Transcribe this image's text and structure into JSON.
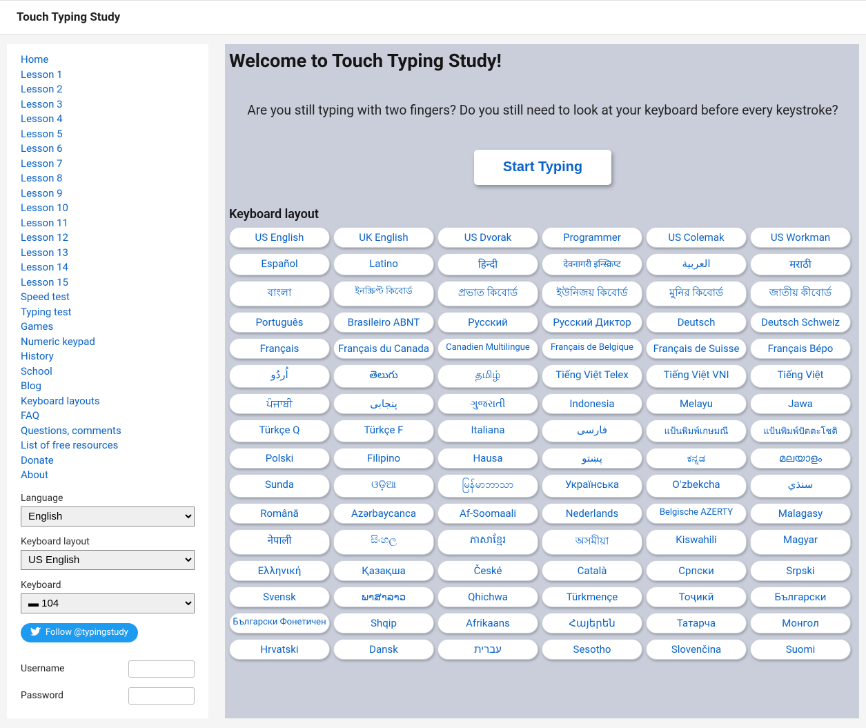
{
  "header": {
    "title": "Touch Typing Study"
  },
  "sidebar": {
    "links": [
      "Home",
      "Lesson 1",
      "Lesson 2",
      "Lesson 3",
      "Lesson 4",
      "Lesson 5",
      "Lesson 6",
      "Lesson 7",
      "Lesson 8",
      "Lesson 9",
      "Lesson 10",
      "Lesson 11",
      "Lesson 12",
      "Lesson 13",
      "Lesson 14",
      "Lesson 15",
      "Speed test",
      "Typing test",
      "Games",
      "Numeric keypad",
      "History",
      "School",
      "Blog",
      "Keyboard layouts",
      "FAQ",
      "Questions, comments",
      "List of free resources",
      "Donate",
      "About"
    ],
    "language_label": "Language",
    "language_value": "English",
    "layout_label": "Keyboard layout",
    "layout_value": "US English",
    "keyboard_label": "Keyboard",
    "keyboard_value": "104",
    "twitter_label": "Follow @typingstudy",
    "username_label": "Username",
    "password_label": "Password"
  },
  "main": {
    "title": "Welcome to Touch Typing Study!",
    "prompt": "Are you still typing with two fingers? Do you still need to look at your keyboard before every keystroke?",
    "start_label": "Start Typing",
    "section_title": "Keyboard layout",
    "layouts": [
      {
        "t": "US English"
      },
      {
        "t": "UK English"
      },
      {
        "t": "US Dvorak"
      },
      {
        "t": "Programmer"
      },
      {
        "t": "US Colemak"
      },
      {
        "t": "US Workman"
      },
      {
        "t": "Español"
      },
      {
        "t": "Latino"
      },
      {
        "t": "हिन्दी"
      },
      {
        "t": "देवनागरी इन्स्क्रिप्ट",
        "sm": true
      },
      {
        "t": "العربية"
      },
      {
        "t": "मराठी"
      },
      {
        "t": "বাংলা"
      },
      {
        "t": "ইনস্ক্রিপ্ট কিবোর্ড",
        "sm": true
      },
      {
        "t": "প্রভাত কিবোর্ড"
      },
      {
        "t": "ইউনিজয় কিবোর্ড"
      },
      {
        "t": "মুনির কিবোর্ড"
      },
      {
        "t": "জাতীয় কীবোর্ড"
      },
      {
        "t": "Português"
      },
      {
        "t": "Brasileiro ABNT"
      },
      {
        "t": "Русский"
      },
      {
        "t": "Русский Диктор"
      },
      {
        "t": "Deutsch"
      },
      {
        "t": "Deutsch Schweiz"
      },
      {
        "t": "Français"
      },
      {
        "t": "Français du Canada"
      },
      {
        "t": "Canadien Multilingue",
        "sm": true
      },
      {
        "t": "Français de Belgique",
        "sm": true
      },
      {
        "t": "Français de Suisse"
      },
      {
        "t": "Français Bépo"
      },
      {
        "t": "اُردُو"
      },
      {
        "t": "తెలుగు"
      },
      {
        "t": "தமிழ்"
      },
      {
        "t": "Tiếng Việt Telex"
      },
      {
        "t": "Tiếng Việt VNI"
      },
      {
        "t": "Tiếng Việt"
      },
      {
        "t": "ਪੰਜਾਬੀ"
      },
      {
        "t": "پنجابی"
      },
      {
        "t": "ગુજરાતી"
      },
      {
        "t": "Indonesia"
      },
      {
        "t": "Melayu"
      },
      {
        "t": "Jawa"
      },
      {
        "t": "Türkçe Q"
      },
      {
        "t": "Türkçe F"
      },
      {
        "t": "Italiana"
      },
      {
        "t": "فارسی"
      },
      {
        "t": "แป้นพิมพ์เกษมณี",
        "sm": true
      },
      {
        "t": "แป้นพิมพ์ปัตตะโชติ",
        "sm": true
      },
      {
        "t": "Polski"
      },
      {
        "t": "Filipino"
      },
      {
        "t": "Hausa"
      },
      {
        "t": "پښتو"
      },
      {
        "t": "ಕನ್ನಡ"
      },
      {
        "t": "മലയാളം"
      },
      {
        "t": "Sunda"
      },
      {
        "t": "ଓଡ଼ିଆ"
      },
      {
        "t": "မြန်မာဘာသာ"
      },
      {
        "t": "Українська"
      },
      {
        "t": "Oʻzbekcha"
      },
      {
        "t": "سنڌي"
      },
      {
        "t": "Română"
      },
      {
        "t": "Azərbaycanca"
      },
      {
        "t": "Af-Soomaali"
      },
      {
        "t": "Nederlands"
      },
      {
        "t": "Belgische AZERTY",
        "sm": true
      },
      {
        "t": "Malagasy"
      },
      {
        "t": "नेपाली"
      },
      {
        "t": "සිංහල"
      },
      {
        "t": "ភាសាខ្មែរ"
      },
      {
        "t": "অসমীয়া"
      },
      {
        "t": "Kiswahili"
      },
      {
        "t": "Magyar"
      },
      {
        "t": "Ελληνική"
      },
      {
        "t": "Қазақша"
      },
      {
        "t": "České"
      },
      {
        "t": "Català"
      },
      {
        "t": "Српски"
      },
      {
        "t": "Srpski"
      },
      {
        "t": "Svensk"
      },
      {
        "t": "ພາສາລາວ"
      },
      {
        "t": "Qhichwa"
      },
      {
        "t": "Türkmençe"
      },
      {
        "t": "Тоҷикӣ"
      },
      {
        "t": "Български"
      },
      {
        "t": "Български Фонетичен",
        "sm": true
      },
      {
        "t": "Shqip"
      },
      {
        "t": "Afrikaans"
      },
      {
        "t": "Հայերեն"
      },
      {
        "t": "Татарча"
      },
      {
        "t": "Монгол"
      },
      {
        "t": "Hrvatski"
      },
      {
        "t": "Dansk"
      },
      {
        "t": "עברית"
      },
      {
        "t": "Sesotho"
      },
      {
        "t": "Slovenčina"
      },
      {
        "t": "Suomi"
      }
    ]
  }
}
